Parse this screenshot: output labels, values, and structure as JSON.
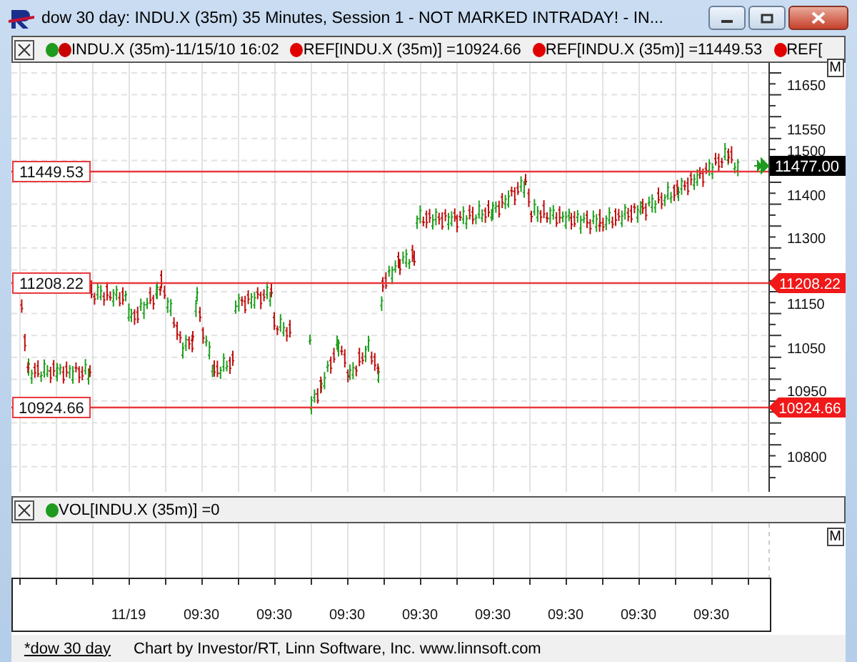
{
  "window": {
    "title": "dow 30 day: INDU.X (35m) 35 Minutes, Session 1 - NOT MARKED INTRADAY! - IN..."
  },
  "legend": [
    {
      "dots": [
        {
          "color": "#1e9a1e"
        },
        {
          "color": "#c80000"
        }
      ],
      "text": "INDU.X (35m)-11/15/10 16:02"
    },
    {
      "dots": [
        {
          "color": "#e00000"
        }
      ],
      "text": "REF[INDU.X (35m)] =10924.66"
    },
    {
      "dots": [
        {
          "color": "#e00000"
        }
      ],
      "text": "REF[INDU.X (35m)] =11449.53"
    },
    {
      "dots": [
        {
          "color": "#e00000"
        }
      ],
      "text": "REF["
    }
  ],
  "price_pane": {
    "button": "M",
    "last_price": "11477.00",
    "axis_labels": [
      "11650",
      "11550",
      "11500",
      "11400",
      "11300",
      "11150",
      "11050",
      "10950",
      "10800"
    ],
    "reference_lines": [
      {
        "label": "11449.53"
      },
      {
        "label": "11208.22",
        "tag": "11208.22"
      },
      {
        "label": "10924.66",
        "tag": "10924.66"
      }
    ]
  },
  "volume_pane": {
    "legend": {
      "dots": [
        {
          "color": "#1e9a1e"
        }
      ],
      "text": "VOL[INDU.X (35m)] =0"
    },
    "button": "M"
  },
  "time_axis": [
    "11/19",
    "09:30",
    "09:30",
    "09:30",
    "09:30",
    "09:30",
    "09:30",
    "09:30",
    "09:30"
  ],
  "footer": {
    "tab": "*dow 30 day",
    "credit": "Chart by Investor/RT, Linn Software, Inc. www.linnsoft.com"
  }
}
